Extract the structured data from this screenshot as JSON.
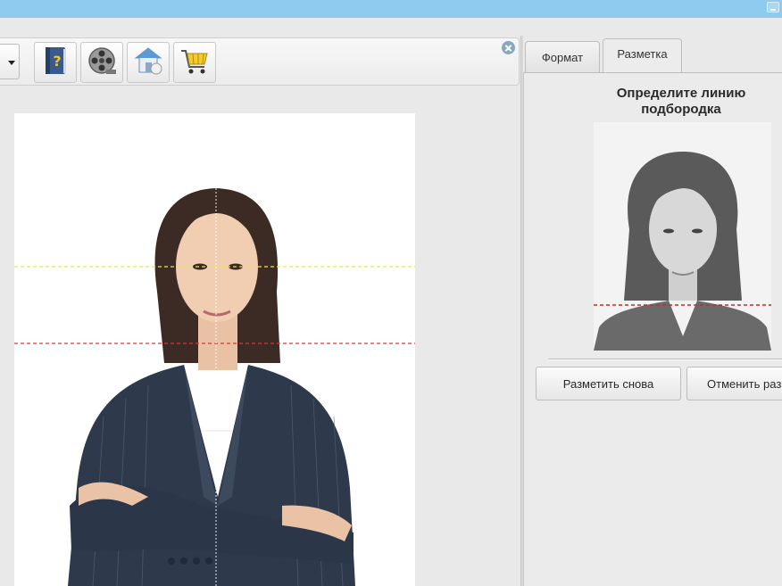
{
  "window": {
    "minimize_icon": "minimize-icon"
  },
  "toolbar": {
    "buttons": [
      {
        "icon": "help-book-icon",
        "color": "#3a5a8c"
      },
      {
        "icon": "film-reel-icon",
        "color": "#8c8c8c"
      },
      {
        "icon": "home-icon",
        "color": "#5b9bd5"
      },
      {
        "icon": "shopping-cart-icon",
        "color": "#e8c020"
      }
    ],
    "dropdown_icon": "chevron-down-icon",
    "close_icon": "close-icon"
  },
  "canvas": {
    "guide_colors": {
      "eye_line": "#e8e84a",
      "chin_line": "#d43b3b",
      "center_line": "#ffffff"
    }
  },
  "tabs": [
    {
      "label": "Формат",
      "active": false
    },
    {
      "label": "Разметка",
      "active": true
    }
  ],
  "markup_panel": {
    "instruction_line1": "Определите линию",
    "instruction_line2": "подбородка",
    "chin_line_color": "#c62828",
    "buttons": {
      "redo_label": "Разметить снова",
      "cancel_label": "Отменить разм"
    }
  }
}
